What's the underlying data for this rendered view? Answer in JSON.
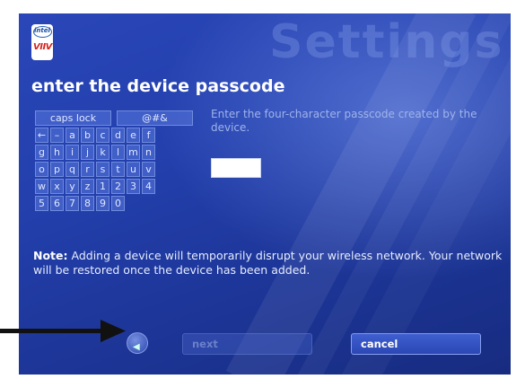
{
  "window": {
    "watermark": "Settings"
  },
  "logo": {
    "brand_top": "intel",
    "brand_bottom": "VIIV"
  },
  "page": {
    "title": "enter the device passcode"
  },
  "keyboard": {
    "special_keys": [
      "caps lock",
      "@#&"
    ],
    "rows": [
      [
        "←",
        "–",
        "a",
        "b",
        "c",
        "d",
        "e",
        "f"
      ],
      [
        "g",
        "h",
        "i",
        "j",
        "k",
        "l",
        "m",
        "n"
      ],
      [
        "o",
        "p",
        "q",
        "r",
        "s",
        "t",
        "u",
        "v"
      ],
      [
        "w",
        "x",
        "y",
        "z",
        "1",
        "2",
        "3",
        "4"
      ],
      [
        "5",
        "6",
        "7",
        "8",
        "9",
        "0"
      ]
    ]
  },
  "instructions": "Enter the four-character passcode created by the device.",
  "passcode_field": {
    "value": ""
  },
  "note": {
    "label": "Note:",
    "text": " Adding a device will temporarily disrupt your wireless network. Your network will be restored once the device has been added."
  },
  "buttons": {
    "next": "next",
    "cancel": "cancel"
  },
  "colors": {
    "background": "#2340ad",
    "accent": "#3f5fd0",
    "text": "#ffffff"
  }
}
